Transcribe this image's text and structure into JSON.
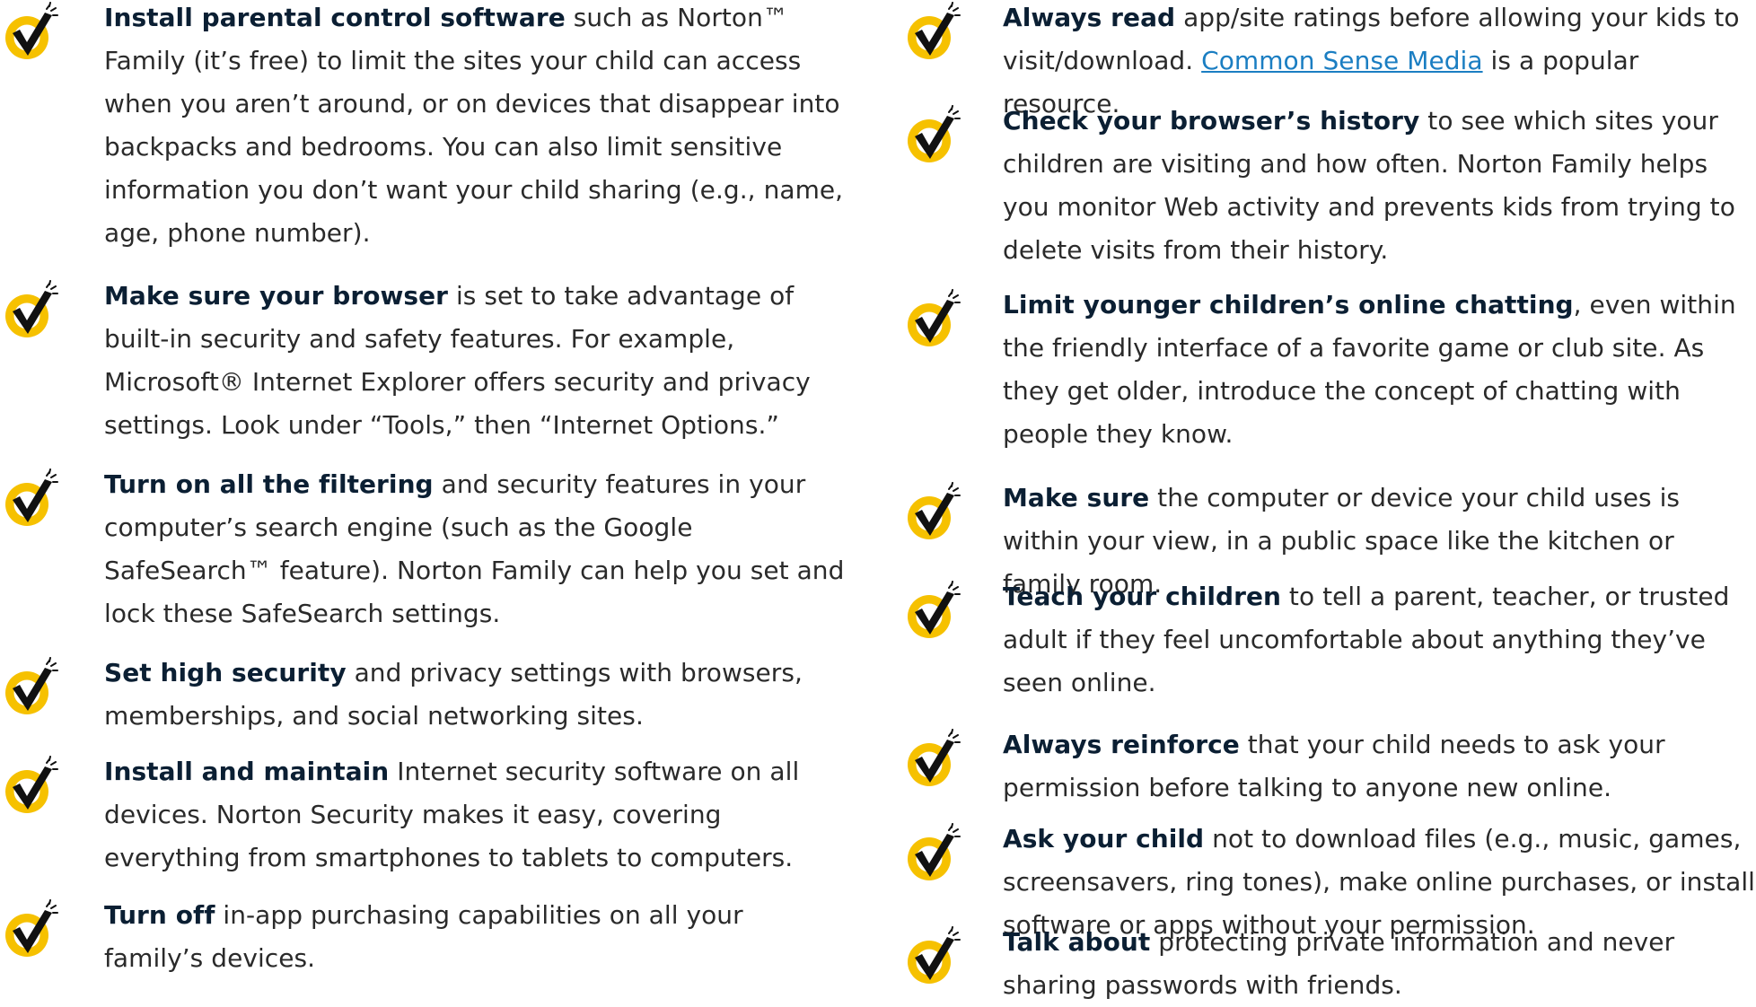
{
  "colors": {
    "badge_yellow": "#f6c100",
    "badge_check": "#111111",
    "heading_text": "#0b1f33",
    "body_text": "#2a2a2a",
    "link": "#1b7ec2"
  },
  "badge_icon": "checkmark-badge-icon",
  "left_tips": [
    {
      "lead": "Install parental control software",
      "text": " such as Norton™ Family (it’s free) to limit the sites your child can access when you aren’t around, or on devices that disappear into backpacks and bedrooms. You can also limit sensitive information you don’t want your child sharing (e.g., name, age, phone number)."
    },
    {
      "lead": "Make sure your browser",
      "text": " is set to take advantage of built-in security and safety features. For example, Microsoft® Internet Explorer offers security and privacy settings. Look under “Tools,” then “Internet Options.”"
    },
    {
      "lead": "Turn on all the filtering",
      "text": " and security features in your computer’s search engine (such as the Google SafeSearch™ feature). Norton Family can help you set and lock these SafeSearch settings."
    },
    {
      "lead": "Set high security",
      "text": " and privacy settings with browsers, memberships, and social networking sites."
    },
    {
      "lead": "Install and maintain",
      "text": " Internet security software on all devices. Norton Security makes it easy, covering everything from smartphones to tablets to computers."
    },
    {
      "lead": "Turn off",
      "text": " in-app purchasing capabilities on all your family’s devices."
    }
  ],
  "right_tips": [
    {
      "lead": "Always read",
      "text": " app/site ratings before allowing your kids to visit/download. ",
      "link": "Common Sense Media",
      "text_after": " is a popular resource."
    },
    {
      "lead": "Check your browser’s history",
      "text": " to see which sites your children are visiting and how often. Norton Family helps you monitor Web activity and prevents kids from trying to delete visits from their history."
    },
    {
      "lead": "Limit younger children’s online chatting",
      "text": ", even within the friendly interface of a favorite game or club site. As they get older, introduce the concept of chatting with people they know."
    },
    {
      "lead": "Make sure",
      "text": " the computer or device your child uses is within your view, in a public space like the kitchen or family room."
    },
    {
      "lead": "Teach your children",
      "text": " to tell a parent, teacher, or trusted adult if they feel uncomfortable about anything they’ve seen online."
    },
    {
      "lead": "Always reinforce",
      "text": " that your child needs to ask your permission before talking to anyone new online."
    },
    {
      "lead": "Ask your child",
      "text": " not to download files (e.g., music, games, screensavers, ring tones), make online purchases, or install software or apps without your permission."
    },
    {
      "lead": "Talk about",
      "text": " protecting private information and never sharing passwords with friends."
    }
  ]
}
